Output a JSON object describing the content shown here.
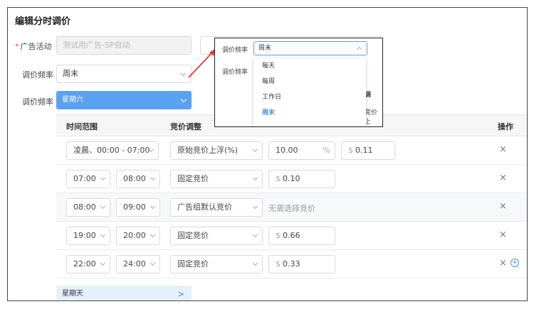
{
  "title": "编辑分时调价",
  "form": {
    "campaign_label": "广告活动",
    "campaign_required_mark": "*",
    "campaign_value": "测试用广告-SP自动",
    "freq_label": "调价频率",
    "freq_value": "周末",
    "day_label": "调价频率",
    "day_value": "星期六"
  },
  "table": {
    "headers": {
      "time": "时间范围",
      "bid": "竞价调整",
      "ops": "操作"
    },
    "rows": [
      {
        "start": "凌晨、00:00 - 07:00",
        "end": "",
        "type": "原始竞价上浮(%)",
        "percent": "10.00",
        "percent_unit": "%",
        "currency": "$",
        "amount": "0.11",
        "note": ""
      },
      {
        "start": "07:00",
        "end": "08:00",
        "type": "固定竞价",
        "percent": "",
        "percent_unit": "",
        "currency": "$",
        "amount": "0.10",
        "note": ""
      },
      {
        "start": "08:00",
        "end": "09:00",
        "type": "广告组默认竞价",
        "percent": "",
        "percent_unit": "",
        "currency": "",
        "amount": "",
        "note": "无需选择竞价"
      },
      {
        "start": "19:00",
        "end": "20:00",
        "type": "固定竞价",
        "percent": "",
        "percent_unit": "",
        "currency": "$",
        "amount": "0.66",
        "note": ""
      },
      {
        "start": "22:00",
        "end": "24:00",
        "type": "固定竞价",
        "percent": "",
        "percent_unit": "",
        "currency": "$",
        "amount": "0.33",
        "note": ""
      }
    ],
    "delete_glyph": "×",
    "add_glyph": "+"
  },
  "sunday_bar": {
    "label": "星期天",
    "arrow": ">"
  },
  "callout": {
    "label1": "调价频率",
    "select_value": "周末",
    "label2": "调价频率",
    "options": [
      "每天",
      "每周",
      "工作日",
      "周末"
    ],
    "active_option": "周末",
    "peek_header": "调",
    "peek_cell": "竞价上"
  },
  "colors": {
    "accent": "#5aa2ef",
    "link": "#4a90e2",
    "required": "#f04848",
    "arrow": "#e03a3a"
  },
  "icons": {
    "delete": "close-icon",
    "add": "plus-circle-icon",
    "dropdown": "chevron-down-icon",
    "dropdown_open": "chevron-up-icon"
  }
}
